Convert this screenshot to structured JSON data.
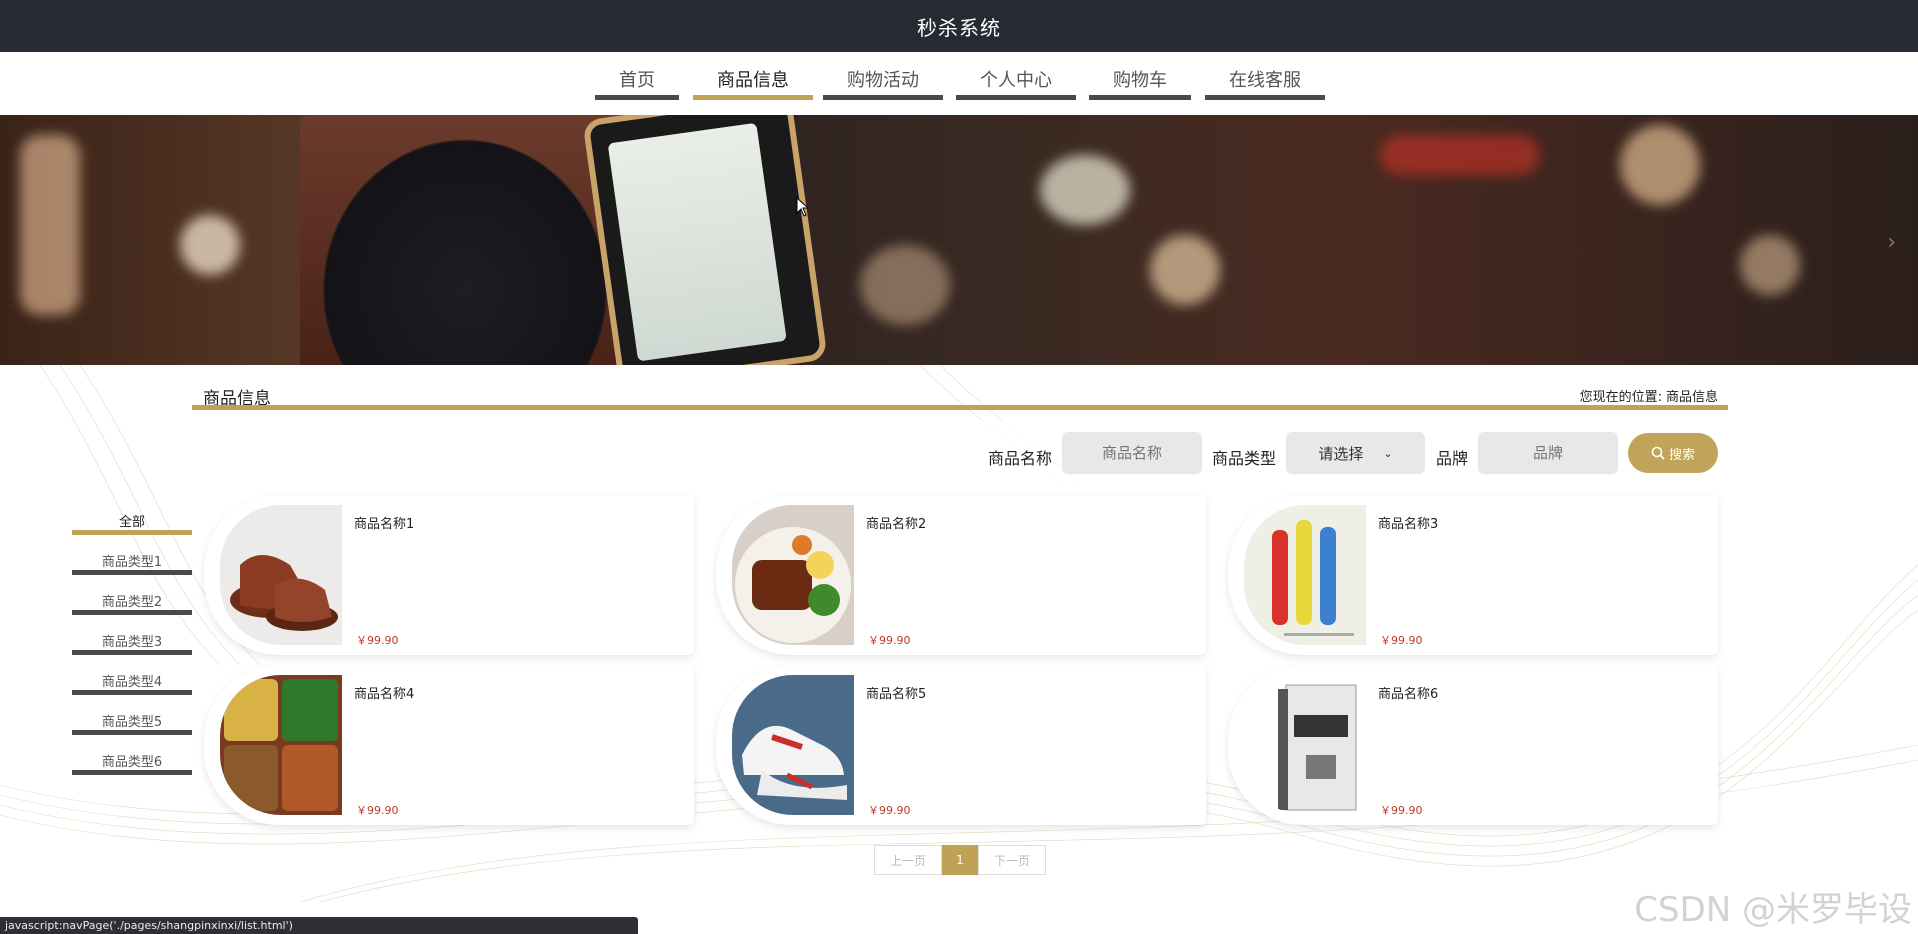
{
  "app": {
    "title": "秒杀系统"
  },
  "nav": {
    "items": [
      {
        "label": "首页",
        "active": false
      },
      {
        "label": "商品信息",
        "active": true
      },
      {
        "label": "购物活动",
        "active": false
      },
      {
        "label": "个人中心",
        "active": false
      },
      {
        "label": "购物车",
        "active": false
      },
      {
        "label": "在线客服",
        "active": false
      }
    ]
  },
  "section": {
    "title": "商品信息",
    "breadcrumb_prefix": "您现在的位置:",
    "breadcrumb_current": "商品信息"
  },
  "search": {
    "name_label": "商品名称",
    "name_placeholder": "商品名称",
    "type_label": "商品类型",
    "type_selected": "请选择",
    "brand_label": "品牌",
    "brand_placeholder": "品牌",
    "button_label": "搜索"
  },
  "categories": [
    {
      "label": "全部",
      "active": true
    },
    {
      "label": "商品类型1",
      "active": false
    },
    {
      "label": "商品类型2",
      "active": false
    },
    {
      "label": "商品类型3",
      "active": false
    },
    {
      "label": "商品类型4",
      "active": false
    },
    {
      "label": "商品类型5",
      "active": false
    },
    {
      "label": "商品类型6",
      "active": false
    }
  ],
  "products": [
    {
      "name": "商品名称1",
      "price": "￥99.90",
      "image": "shoes-icon"
    },
    {
      "name": "商品名称2",
      "price": "￥99.90",
      "image": "food-dish-icon"
    },
    {
      "name": "商品名称3",
      "price": "￥99.90",
      "image": "bottles-icon"
    },
    {
      "name": "商品名称4",
      "price": "￥99.90",
      "image": "bento-box-icon"
    },
    {
      "name": "商品名称5",
      "price": "￥99.90",
      "image": "sneaker-icon"
    },
    {
      "name": "商品名称6",
      "price": "￥99.90",
      "image": "book-icon"
    }
  ],
  "pagination": {
    "prev": "上一页",
    "current": "1",
    "next": "下一页"
  },
  "status_bar": {
    "text": "javascript:navPage('./pages/shangpinxinxi/list.html')"
  },
  "watermark": {
    "text": "CSDN @米罗毕设"
  },
  "colors": {
    "accent": "#bfa256",
    "topbar": "#262a33",
    "price": "#c0392b"
  }
}
